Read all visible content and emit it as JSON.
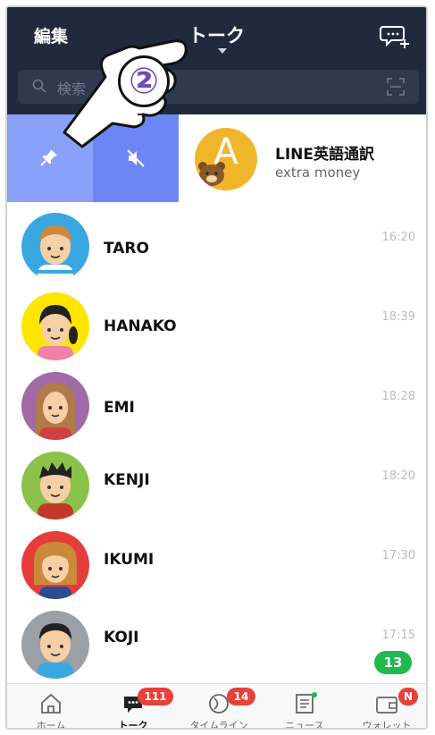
{
  "header": {
    "edit_label": "編集",
    "title": "トーク",
    "new_chat_icon": "new-chat-icon"
  },
  "search": {
    "placeholder": "検索",
    "scan_icon": "scan-icon"
  },
  "swipe_actions": [
    {
      "name": "pin",
      "icon": "pin-icon",
      "color": "#8aa1f9"
    },
    {
      "name": "mute",
      "icon": "mute-icon",
      "color": "#6d86f5"
    }
  ],
  "pinned_chat": {
    "avatar_letter": "A",
    "name": "LINE英語通訳",
    "subtitle": "extra money"
  },
  "chats": [
    {
      "name": "TARO",
      "time": "16:20",
      "bg": "#3aa8e0"
    },
    {
      "name": "HANAKO",
      "time": "18:39",
      "bg": "#ffe600"
    },
    {
      "name": "EMI",
      "time": "18:28",
      "bg": "#a16aa6"
    },
    {
      "name": "KENJI",
      "time": "18:20",
      "bg": "#8dc24a"
    },
    {
      "name": "IKUMI",
      "time": "17:30",
      "bg": "#e63c3c"
    },
    {
      "name": "KOJI",
      "time": "17:15",
      "bg": "#9aa0a6"
    }
  ],
  "unread_count": "13",
  "tabbar": {
    "tabs": [
      {
        "label": "ホーム",
        "icon": "home-icon",
        "badge": ""
      },
      {
        "label": "トーク",
        "icon": "chat-icon",
        "badge": "111"
      },
      {
        "label": "タイムライン",
        "icon": "timeline-icon",
        "badge": "14"
      },
      {
        "label": "ニュース",
        "icon": "news-icon",
        "badge": ""
      },
      {
        "label": "ウォレット",
        "icon": "wallet-icon",
        "badge": "N"
      }
    ]
  },
  "annotation": {
    "step_number": "②"
  }
}
